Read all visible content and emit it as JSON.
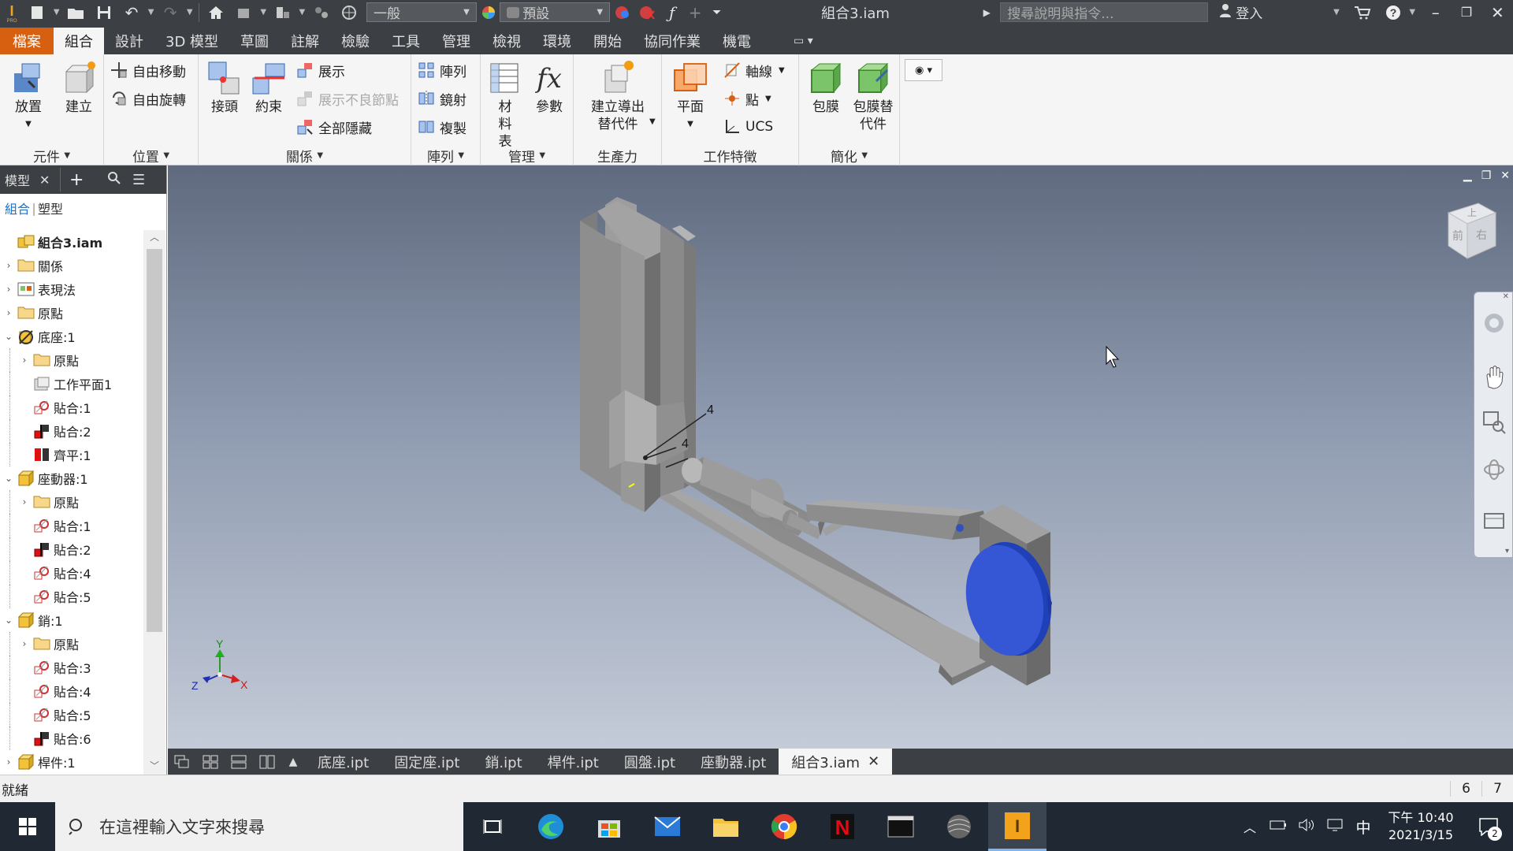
{
  "qat": {
    "style_combo": "一般",
    "appearance_combo": "預設",
    "doc_title": "組合3.iam",
    "search_placeholder": "搜尋說明與指令...",
    "signin": "登入"
  },
  "menu": {
    "tabs": [
      "檔案",
      "組合",
      "設計",
      "3D 模型",
      "草圖",
      "註解",
      "檢驗",
      "工具",
      "管理",
      "檢視",
      "環境",
      "開始",
      "協同作業",
      "機電"
    ]
  },
  "ribbon": {
    "component": {
      "label": "元件",
      "place": "放置",
      "create": "建立"
    },
    "position": {
      "label": "位置",
      "free_move": "自由移動",
      "free_rotate": "自由旋轉"
    },
    "relationships": {
      "label": "關係",
      "joint": "接頭",
      "constrain": "約束",
      "show": "展示",
      "show_sick": "展示不良節點",
      "hide_all": "全部隱藏"
    },
    "pattern": {
      "label": "陣列",
      "pattern": "陣列",
      "mirror": "鏡射",
      "copy": "複製"
    },
    "manage": {
      "label": "管理",
      "bom": "材料表",
      "params": "參數"
    },
    "productivity": {
      "label": "生產力",
      "create_substitute": "建立導出替代件"
    },
    "work_features": {
      "label": "工作特徵",
      "plane": "平面",
      "axis": "軸線",
      "point": "點",
      "ucs": "UCS"
    },
    "simplification": {
      "label": "簡化",
      "shrinkwrap": "包膜",
      "shrinkwrap_sub": "包膜替代件"
    }
  },
  "browser": {
    "title": "模型",
    "tab_assembly": "組合",
    "tab_modeling": "塑型",
    "tree": [
      {
        "label": "組合3.iam",
        "level": 0,
        "tw": "",
        "icon": "assembly",
        "bold": true
      },
      {
        "label": "關係",
        "level": 0,
        "tw": "›",
        "icon": "folder"
      },
      {
        "label": "表現法",
        "level": 0,
        "tw": "›",
        "icon": "rep"
      },
      {
        "label": "原點",
        "level": 0,
        "tw": "›",
        "icon": "folder"
      },
      {
        "label": "底座:1",
        "level": 0,
        "tw": "⌄",
        "icon": "grounded"
      },
      {
        "label": "原點",
        "level": 1,
        "tw": "›",
        "icon": "folder"
      },
      {
        "label": "工作平面1",
        "level": 1,
        "tw": "",
        "icon": "plane"
      },
      {
        "label": "貼合:1",
        "level": 1,
        "tw": "",
        "icon": "mate"
      },
      {
        "label": "貼合:2",
        "level": 1,
        "tw": "",
        "icon": "flush"
      },
      {
        "label": "齊平:1",
        "level": 1,
        "tw": "",
        "icon": "flush2"
      },
      {
        "label": "座動器:1",
        "level": 0,
        "tw": "⌄",
        "icon": "part"
      },
      {
        "label": "原點",
        "level": 1,
        "tw": "›",
        "icon": "folder"
      },
      {
        "label": "貼合:1",
        "level": 1,
        "tw": "",
        "icon": "mate"
      },
      {
        "label": "貼合:2",
        "level": 1,
        "tw": "",
        "icon": "flush"
      },
      {
        "label": "貼合:4",
        "level": 1,
        "tw": "",
        "icon": "mate"
      },
      {
        "label": "貼合:5",
        "level": 1,
        "tw": "",
        "icon": "mate"
      },
      {
        "label": "銷:1",
        "level": 0,
        "tw": "⌄",
        "icon": "part"
      },
      {
        "label": "原點",
        "level": 1,
        "tw": "›",
        "icon": "folder"
      },
      {
        "label": "貼合:3",
        "level": 1,
        "tw": "",
        "icon": "mate"
      },
      {
        "label": "貼合:4",
        "level": 1,
        "tw": "",
        "icon": "mate"
      },
      {
        "label": "貼合:5",
        "level": 1,
        "tw": "",
        "icon": "mate"
      },
      {
        "label": "貼合:6",
        "level": 1,
        "tw": "",
        "icon": "flush"
      },
      {
        "label": "桿件:1",
        "level": 0,
        "tw": "›",
        "icon": "part"
      }
    ]
  },
  "viewcube": {
    "front": "前",
    "right": "右",
    "top": "上"
  },
  "triad": {
    "x": "X",
    "y": "Y",
    "z": "Z"
  },
  "dimensions": [
    "4",
    "4"
  ],
  "doc_tabs": [
    "底座.ipt",
    "固定座.ipt",
    "銷.ipt",
    "桿件.ipt",
    "圓盤.ipt",
    "座動器.ipt",
    "組合3.iam"
  ],
  "status": {
    "text": "就緒",
    "n1": "6",
    "n2": "7"
  },
  "taskbar": {
    "search_placeholder": "在這裡輸入文字來搜尋",
    "time": "下午 10:40",
    "date": "2021/3/15",
    "ime": "中",
    "notif_count": "2"
  }
}
